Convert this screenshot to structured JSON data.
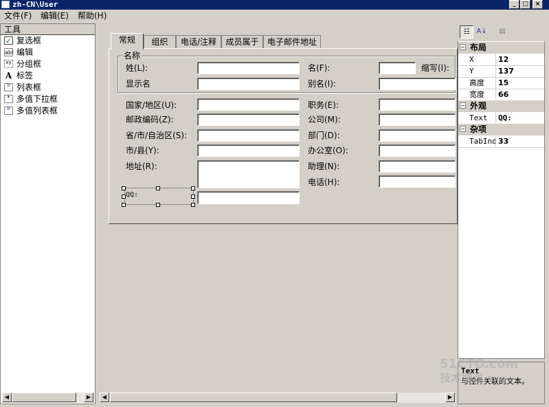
{
  "window": {
    "title": "zh-CN\\User",
    "buttons": {
      "minimize": "_",
      "maximize": "□",
      "close": "×"
    }
  },
  "menu": [
    "文件(F)",
    "编辑(E)",
    "帮助(H)"
  ],
  "toolbox": {
    "title": "工具",
    "items": [
      {
        "label": "复选框",
        "icon": "checkbox-icon"
      },
      {
        "label": "编辑",
        "icon": "textbox-icon",
        "glyph": "abl"
      },
      {
        "label": "分组框",
        "icon": "groupbox-icon",
        "glyph": "xy"
      },
      {
        "label": "标签",
        "icon": "label-icon",
        "glyph": "A"
      },
      {
        "label": "列表框",
        "icon": "listbox-icon"
      },
      {
        "label": "多值下拉框",
        "icon": "combobox-icon"
      },
      {
        "label": "多值列表框",
        "icon": "multilist-icon"
      }
    ]
  },
  "form": {
    "tabs": [
      "常规",
      "组织",
      "电话/注释",
      "成员属于",
      "电子邮件地址"
    ],
    "active_tab": 0,
    "group_title": "名称",
    "labels": {
      "last_name": "姓(L):",
      "first_name": "名(F):",
      "initials": "缩写(I):",
      "display_name": "显示名",
      "alias": "别名(I):",
      "country": "国家/地区(U):",
      "postal": "邮政编码(Z):",
      "province": "省/市/自治区(S):",
      "city": "市/县(Y):",
      "address": "地址(R):",
      "qq": "QQ:",
      "title": "职务(E):",
      "company": "公司(M):",
      "department": "部门(D):",
      "office": "办公室(O):",
      "assistant": "助理(N):",
      "phone": "电话(H):"
    }
  },
  "properties": {
    "categories": [
      {
        "name": "布局",
        "toggle": "⊟",
        "rows": [
          {
            "name": "X",
            "value": "12"
          },
          {
            "name": "Y",
            "value": "137"
          },
          {
            "name": "高度",
            "value": "15"
          },
          {
            "name": "宽度",
            "value": "66"
          }
        ]
      },
      {
        "name": "外观",
        "toggle": "⊟",
        "rows": [
          {
            "name": "Text",
            "value": "QQ:"
          }
        ]
      },
      {
        "name": "杂项",
        "toggle": "⊟",
        "rows": [
          {
            "name": "TabInd",
            "value": "33"
          }
        ]
      }
    ],
    "description_title": "Text",
    "description_text": "与控件关联的文本。"
  },
  "watermark": {
    "line1": "51CTO.com",
    "line2": "技术博客",
    "line3": "Blog"
  },
  "colors": {
    "titlebar": "#0a246a",
    "face": "#d4d0c8",
    "window": "#ffffff"
  }
}
